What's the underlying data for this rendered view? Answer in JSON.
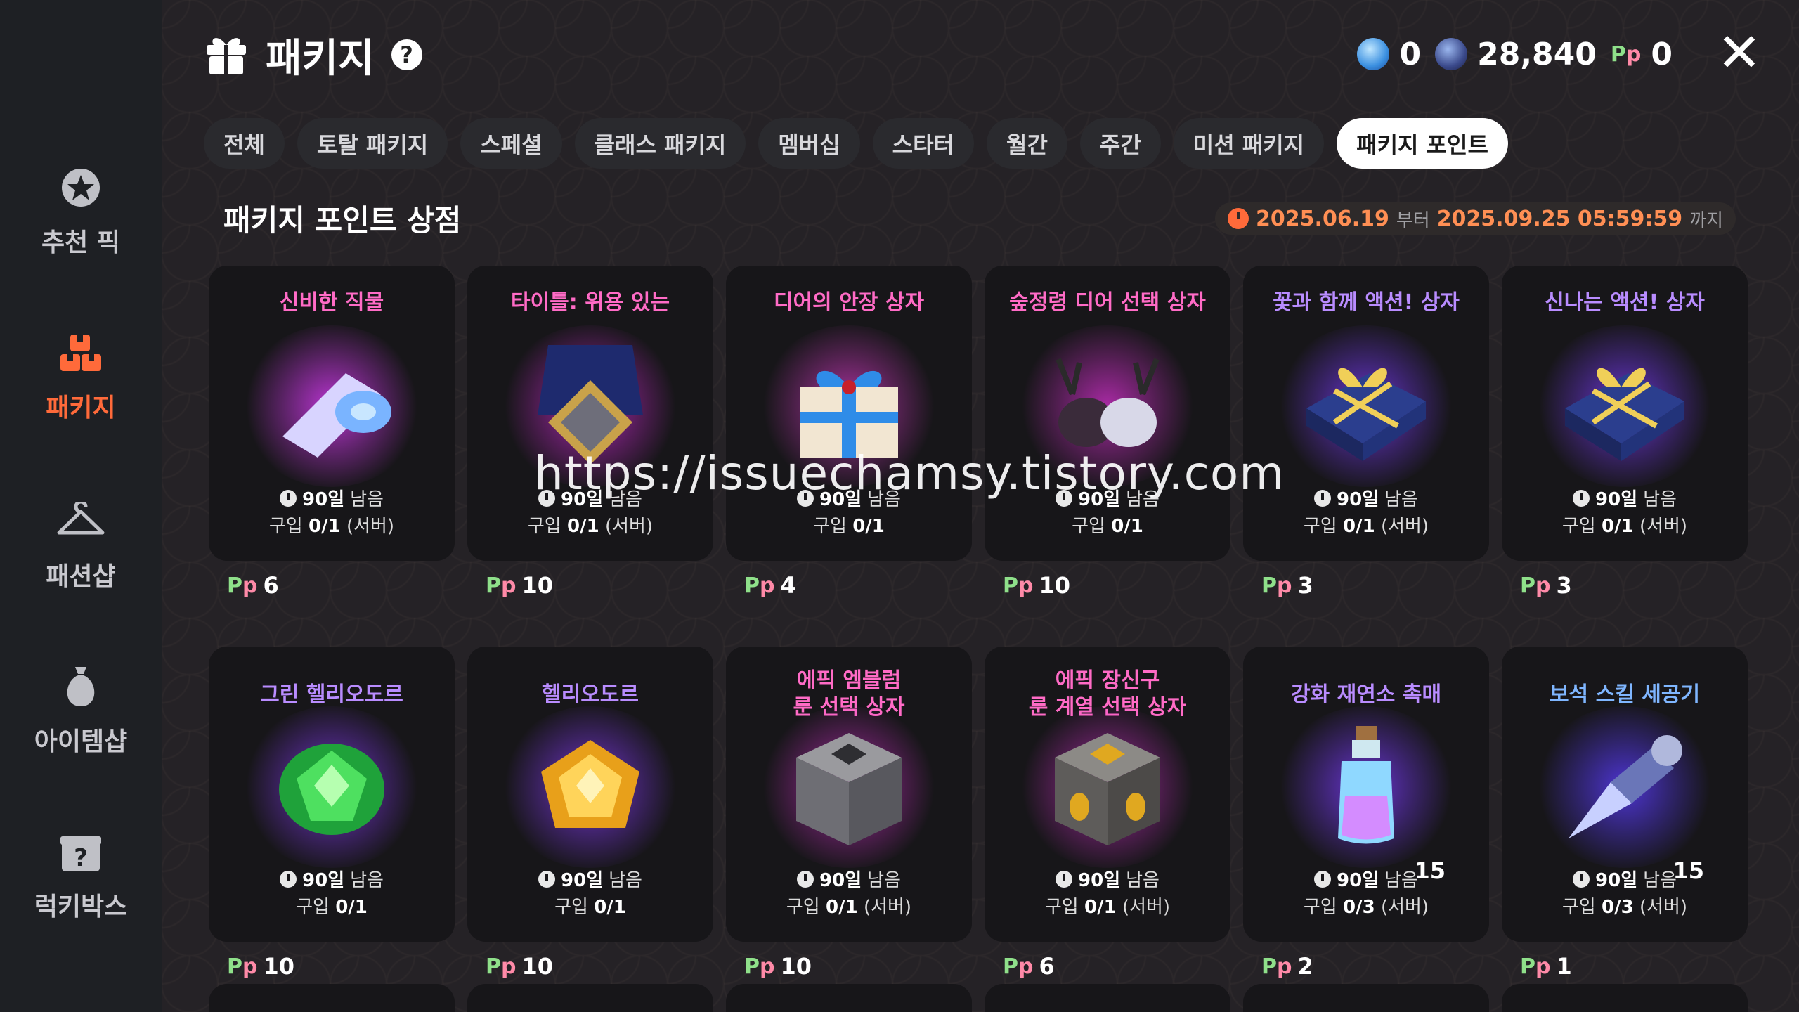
{
  "sidebar": {
    "items": [
      {
        "label": "추천 픽",
        "icon": "star-badge-icon",
        "active": false
      },
      {
        "label": "패키지",
        "icon": "package-boxes-icon",
        "active": true
      },
      {
        "label": "패션샵",
        "icon": "hanger-icon",
        "active": false
      },
      {
        "label": "아이템샵",
        "icon": "money-bag-icon",
        "active": false
      },
      {
        "label": "럭키박스",
        "icon": "lucky-box-icon",
        "active": false
      }
    ]
  },
  "header": {
    "title": "패키지",
    "help": "?",
    "close": "✕"
  },
  "currency": [
    {
      "icon": "blue-crystal-coin-icon",
      "value": "0"
    },
    {
      "icon": "dark-blue-coin-icon",
      "value": "28,840"
    },
    {
      "icon": "package-point-icon",
      "value": "0"
    }
  ],
  "tabs": [
    "전체",
    "토탈 패키지",
    "스페셜",
    "클래스 패키지",
    "멤버십",
    "스타터",
    "월간",
    "주간",
    "미션 패키지",
    "패키지 포인트"
  ],
  "active_tab": "패키지 포인트",
  "section": {
    "title": "패키지 포인트 상점",
    "period_start": "2025.06.19",
    "from_text": "부터",
    "period_end": "2025.09.25 05:59:59",
    "until_text": "까지"
  },
  "point_icon": "Pp",
  "products": [
    {
      "name": "신비한 직물",
      "remain": "90일",
      "remain_suffix": "남음",
      "buy_label": "구입",
      "buy_count": "0/1",
      "scope": "(서버)",
      "price": "6",
      "art": "scroll-icon",
      "glow": "#e13cff"
    },
    {
      "name": "타이틀: 위용 있는",
      "remain": "90일",
      "remain_suffix": "남음",
      "buy_label": "구입",
      "buy_count": "0/1",
      "scope": "(서버)",
      "price": "10",
      "art": "medal-icon",
      "glow": "#d22bd8"
    },
    {
      "name": "디어의 안장 상자",
      "remain": "90일",
      "remain_suffix": "남음",
      "buy_label": "구입",
      "buy_count": "0/1",
      "scope": "",
      "price": "4",
      "art": "gift-box-icon",
      "glow": "#d23ac4"
    },
    {
      "name": "숲정령 디어 선택 상자",
      "remain": "90일",
      "remain_suffix": "남음",
      "buy_label": "구입",
      "buy_count": "0/1",
      "scope": "",
      "price": "10",
      "art": "deer-icon",
      "glow": "#cc2fc6"
    },
    {
      "name": "꽃과 함께 액션! 상자",
      "remain": "90일",
      "remain_suffix": "남음",
      "buy_label": "구입",
      "buy_count": "0/1",
      "scope": "(서버)",
      "price": "3",
      "art": "navy-gift-icon",
      "glow": "#7b3cff"
    },
    {
      "name": "신나는 액션! 상자",
      "remain": "90일",
      "remain_suffix": "남음",
      "buy_label": "구입",
      "buy_count": "0/1",
      "scope": "(서버)",
      "price": "3",
      "art": "navy-gift-icon",
      "glow": "#7b3cff"
    },
    {
      "name": "그린 헬리오도르",
      "remain": "90일",
      "remain_suffix": "남음",
      "buy_label": "구입",
      "buy_count": "0/1",
      "scope": "",
      "price": "10",
      "art": "green-gem-icon",
      "glow": "#8a3cff"
    },
    {
      "name": "헬리오도르",
      "remain": "90일",
      "remain_suffix": "남음",
      "buy_label": "구입",
      "buy_count": "0/1",
      "scope": "",
      "price": "10",
      "art": "yellow-gem-icon",
      "glow": "#8a3cff"
    },
    {
      "name": "에픽 엠블럼\n룬 선택 상자",
      "remain": "90일",
      "remain_suffix": "남음",
      "buy_label": "구입",
      "buy_count": "0/1",
      "scope": "(서버)",
      "price": "10",
      "art": "stone-chest-icon",
      "glow": "#cc2fc6"
    },
    {
      "name": "에픽 장신구\n룬 계열 선택 상자",
      "remain": "90일",
      "remain_suffix": "남음",
      "buy_label": "구입",
      "buy_count": "0/1",
      "scope": "(서버)",
      "price": "6",
      "art": "gold-chest-icon",
      "glow": "#cc2fc6"
    },
    {
      "name": "강화 재연소 촉매",
      "remain": "90일",
      "remain_suffix": "남음",
      "buy_label": "구입",
      "buy_count": "0/3",
      "scope": "(서버)",
      "price": "2",
      "qty": "15",
      "art": "potion-bottle-icon",
      "glow": "#7b3cff"
    },
    {
      "name": "보석 스킬 세공기",
      "remain": "90일",
      "remain_suffix": "남음",
      "buy_label": "구입",
      "buy_count": "0/3",
      "scope": "(서버)",
      "price": "1",
      "qty": "15",
      "art": "crystal-drill-icon",
      "glow": "#5a3cff"
    }
  ],
  "watermark": "https://issuechamsy.tistory.com",
  "colors": {
    "accent": "#ff6a3a",
    "name_pink": "#ff6bc6",
    "name_violet": "#b98cff",
    "name_blue": "#7fb6ff"
  }
}
